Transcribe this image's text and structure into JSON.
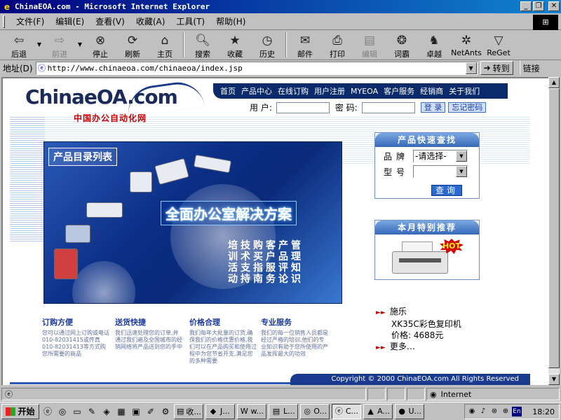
{
  "window": {
    "title": "ChinaEOA.com - Microsoft Internet Explorer"
  },
  "menu": [
    "文件(F)",
    "编辑(E)",
    "查看(V)",
    "收藏(A)",
    "工具(T)",
    "帮助(H)"
  ],
  "toolbar": {
    "back": "后退",
    "forward": "前进",
    "stop": "停止",
    "refresh": "刷新",
    "home": "主页",
    "search": "搜索",
    "favorites": "收藏",
    "history": "历史",
    "mail": "邮件",
    "print": "打印",
    "edit": "编辑",
    "dict": "词霸",
    "zhuoyue": "卓越",
    "netants": "NetAnts",
    "reget": "ReGet"
  },
  "address": {
    "label": "地址(D)",
    "url": "http://www.chinaeoa.com/chinaeoa/index.jsp",
    "go": "转到",
    "links": "链接"
  },
  "site": {
    "logo_text": "ChinaeOA.com",
    "logo_sub": "中国办公自动化网",
    "nav": [
      "首页",
      "产品中心",
      "在线订购",
      "用户注册",
      "MYEOA",
      "客户服务",
      "经销商",
      "关于我们"
    ],
    "login": {
      "user_label": "用 户:",
      "pass_label": "密 码:",
      "login_btn": "登 录",
      "forgot_btn": "忘记密码"
    },
    "banner": {
      "title": "产品目录列表",
      "slogan": "全面办公室解决方案",
      "grid": [
        "培技购客产管",
        "训术买户品理",
        "活支指服评知",
        "动持南务论识"
      ]
    },
    "quick_search": {
      "title": "产品快速查找",
      "brand_label": "品牌",
      "brand_value": "-请选择-",
      "model_label": "型号",
      "model_value": "",
      "search_btn": "查询"
    },
    "monthly": {
      "title": "本月特别推荐",
      "hot": "HOT"
    },
    "promo": {
      "brand": "施乐",
      "model": "XK35C彩色复印机",
      "price": "价格: 4688元",
      "more": "更多…"
    },
    "features": [
      {
        "title": "订购方便",
        "body": "您可以通过网上订购或电话010-82031415或传真010-82031413等方式购您所需要的商品"
      },
      {
        "title": "送货快捷",
        "body": "我们迅速处理您的订单,并通过我们遍及全国城市的经销网络将产品送到您的手中"
      },
      {
        "title": "价格合理",
        "body": "我们每年大批量的订货,确保我们的价格优惠价格,我们可以在产品购买和使用过程中为您节省开支,满足您的多种需要"
      },
      {
        "title": "专业服务",
        "body": "我们的每一位销售人员都是经过严格的培训,他们的专业知识有助于您所使用的产品发挥最大的功效"
      }
    ],
    "copyright": "Copyright © 2000 ChinaEOA.com All Rights Reserved"
  },
  "statusbar": {
    "zone": "Internet"
  },
  "taskbar": {
    "start": "开始",
    "items": [
      "收...",
      "J...",
      "w...",
      "L...",
      "O...",
      "C...",
      "A...",
      "U..."
    ],
    "clock": "18:20",
    "lang": "En"
  }
}
